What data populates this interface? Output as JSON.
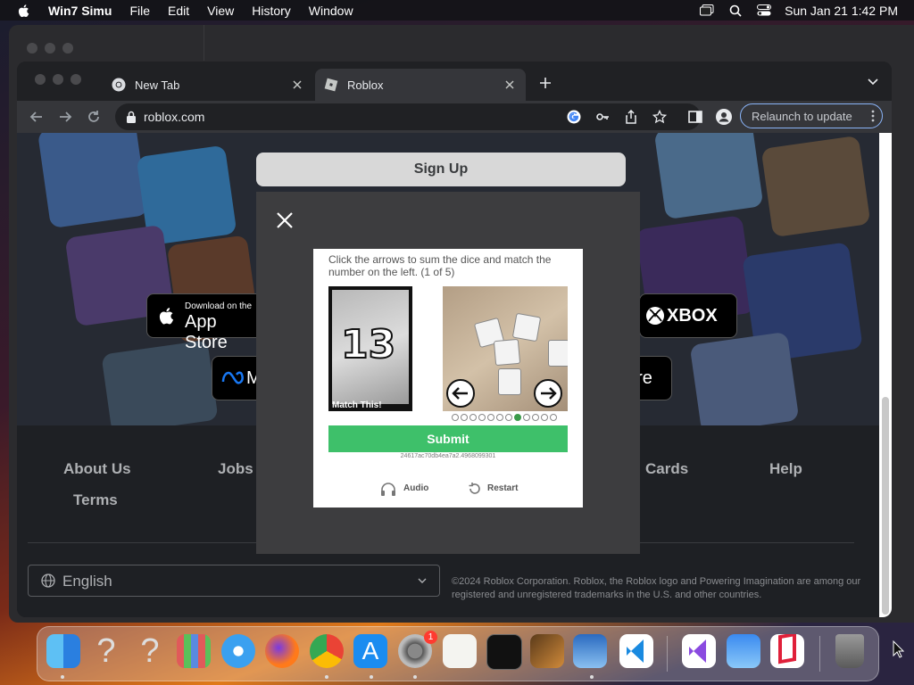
{
  "menubar": {
    "app": "Win7 Simu",
    "items": [
      "File",
      "Edit",
      "View",
      "History",
      "Window"
    ],
    "clock": "Sun Jan 21  1:42 PM"
  },
  "browser": {
    "tabs": [
      {
        "title": "New Tab"
      },
      {
        "title": "Roblox"
      }
    ],
    "url": "roblox.com",
    "relaunch_label": "Relaunch to update"
  },
  "page": {
    "signup_label": "Sign Up",
    "store_buttons": [
      {
        "small": "Download on the",
        "big": "App Store"
      },
      {
        "big": "XBOX"
      },
      {
        "big": "M"
      },
      {
        "big": "ore"
      }
    ],
    "footer_links": [
      "About Us",
      "Jobs",
      "Cards",
      "Help",
      "Terms"
    ],
    "language": "English",
    "copyright": "©2024 Roblox Corporation. Roblox, the Roblox logo and Powering Imagination are among our registered and unregistered trademarks in the U.S. and other countries."
  },
  "captcha": {
    "instruction": "Click the arrows to sum the dice and match the number on the left. (1 of 5)",
    "target_number": "13",
    "match_label": "Match This!",
    "progress": {
      "total": 12,
      "current": 8
    },
    "submit_label": "Submit",
    "token": "24617ac70db4ea7a2.4968099301",
    "audio_label": "Audio",
    "restart_label": "Restart"
  },
  "dock": {
    "apps": [
      "finder-icon",
      "help-icon",
      "help-icon",
      "launchpad-icon",
      "safari-icon",
      "firefox-icon",
      "chrome-icon",
      "app-store-icon",
      "system-settings-icon",
      "textedit-icon",
      "terminal-icon",
      "garageband-icon",
      "preview-icon",
      "vscode-icon",
      "visual-studio-icon",
      "weather-icon",
      "parallels-icon",
      "trash-icon"
    ],
    "settings_badge": "1"
  },
  "colors": {
    "submit": "#3ec06a",
    "relaunch_border": "#8ab4f8",
    "progress_active": "#3b9b4a"
  }
}
